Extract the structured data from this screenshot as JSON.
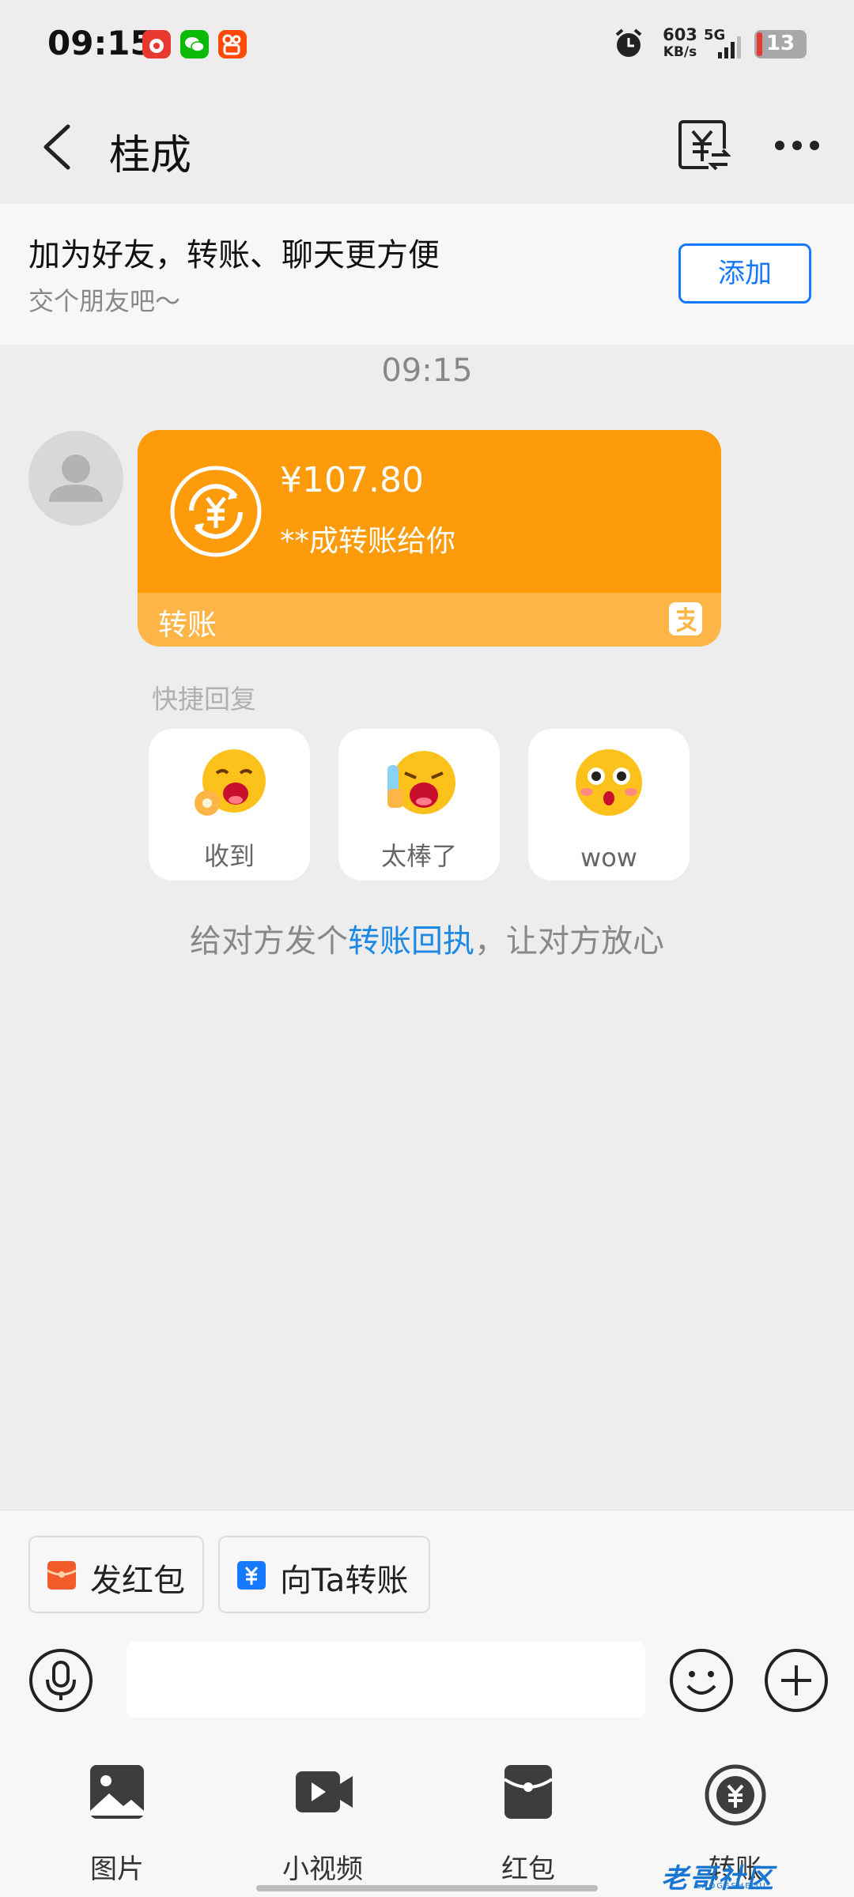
{
  "status_bar": {
    "time": "09:15",
    "net_speed_value": "603",
    "net_speed_unit": "KB/s",
    "network": "5G",
    "battery": "13",
    "icons": [
      "news-app-icon",
      "wechat-icon",
      "kuaishou-icon",
      "alarm-icon",
      "signal-icon",
      "battery-icon"
    ]
  },
  "header": {
    "title": "桂成",
    "icons": [
      "back-arrow-icon",
      "yuan-exchange-icon",
      "more-icon"
    ]
  },
  "banner": {
    "title": "加为好友，转账、聊天更方便",
    "subtitle": "交个朋友吧～",
    "add_label": "添加"
  },
  "chat": {
    "timestamp": "09:15",
    "transfer_card": {
      "amount": "¥107.80",
      "description": "**成转账给你",
      "type_label": "转账",
      "color_top": "#fe9b0a",
      "color_bottom": "#fdb548"
    },
    "quick_reply_label": "快捷回复",
    "quick_replies": [
      {
        "label": "收到",
        "icon": "ok-hand-emoji-icon"
      },
      {
        "label": "太棒了",
        "icon": "thumbs-up-crying-emoji-icon"
      },
      {
        "label": "wow",
        "icon": "surprised-emoji-icon"
      }
    ],
    "receipt_prefix": "给对方发个",
    "receipt_link": "转账回执",
    "receipt_suffix": "，让对方放心"
  },
  "bottom_bar": {
    "chips": [
      {
        "label": "发红包",
        "icon": "red-envelope-icon"
      },
      {
        "label": "向Ta转账",
        "icon": "transfer-icon"
      }
    ],
    "tools": [
      {
        "label": "图片",
        "icon": "image-icon"
      },
      {
        "label": "小视频",
        "icon": "video-icon"
      },
      {
        "label": "红包",
        "icon": "red-packet-icon"
      },
      {
        "label": "转账",
        "icon": "transfer-circle-icon"
      }
    ],
    "watermark": "老哥社区",
    "watermark_sub": "LAOGESHEQU"
  }
}
